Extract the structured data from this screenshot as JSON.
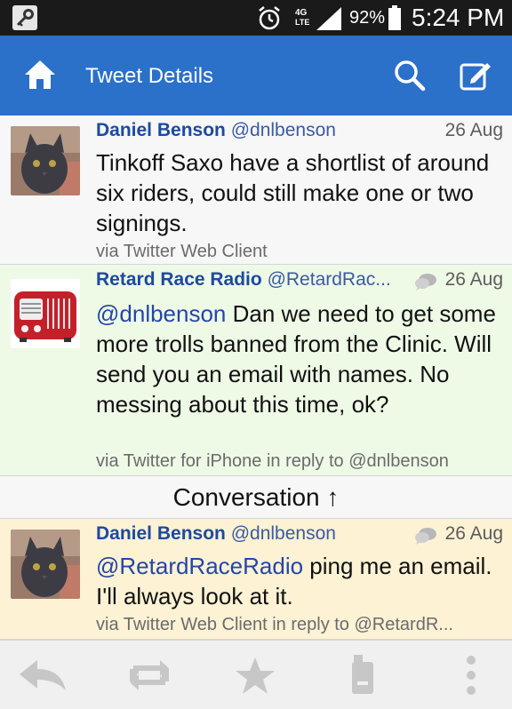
{
  "status": {
    "battery": "92%",
    "time": "5:24 PM",
    "network": "4G LTE"
  },
  "actionbar": {
    "title": "Tweet Details"
  },
  "tweets": [
    {
      "name": "Daniel Benson",
      "handle": "@dnlbenson",
      "date": "26 Aug",
      "text": "Tinkoff Saxo have a shortlist of around six riders, could still make one or two signings.",
      "via": "via Twitter Web Client",
      "avatar": "cat-avatar"
    },
    {
      "name": "Retard Race Radio",
      "handle": "@RetardRac...",
      "date": "26 Aug",
      "mention": "@dnlbenson",
      "text": " Dan we need to get some more trolls banned from the Clinic. Will send you an email with names. No messing about this time, ok?",
      "via": "via Twitter for iPhone in reply to @dnlbenson",
      "avatar": "radio-avatar"
    },
    {
      "name": "Daniel Benson",
      "handle": "@dnlbenson",
      "date": "26 Aug",
      "mention": "@RetardRaceRadio",
      "text": " ping me an email. I'll always look at it.",
      "via": "via Twitter Web Client in reply to @RetardR...",
      "avatar": "cat-avatar"
    }
  ],
  "conversation": {
    "label": "Conversation ↑"
  },
  "bottombar": {
    "icons": [
      "reply-icon",
      "retweet-icon",
      "favorite-icon",
      "mobile-icon",
      "overflow-icon"
    ]
  },
  "colors": {
    "actionbar": "#2b70c9",
    "name": "#1c4aa0",
    "reply_bg": "#eefae6",
    "origin_bg": "#fdf2d4"
  }
}
